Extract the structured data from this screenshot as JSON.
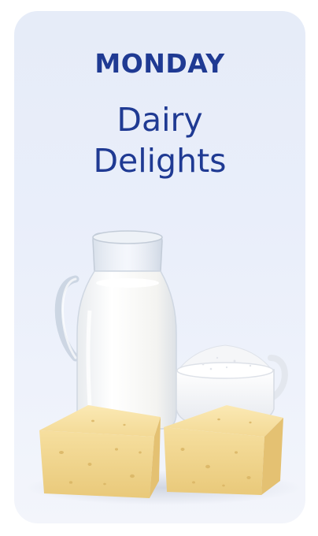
{
  "card": {
    "day_label": "MONDAY",
    "title_line1": "Dairy",
    "title_line2": "Delights"
  },
  "illustration": {
    "items": [
      "milk-jug-icon",
      "flour-bowl-icon",
      "cheese-block-icon",
      "cheese-block-icon"
    ]
  },
  "colors": {
    "text_accent": "#1f3a93",
    "card_background": "#e9eef9"
  }
}
